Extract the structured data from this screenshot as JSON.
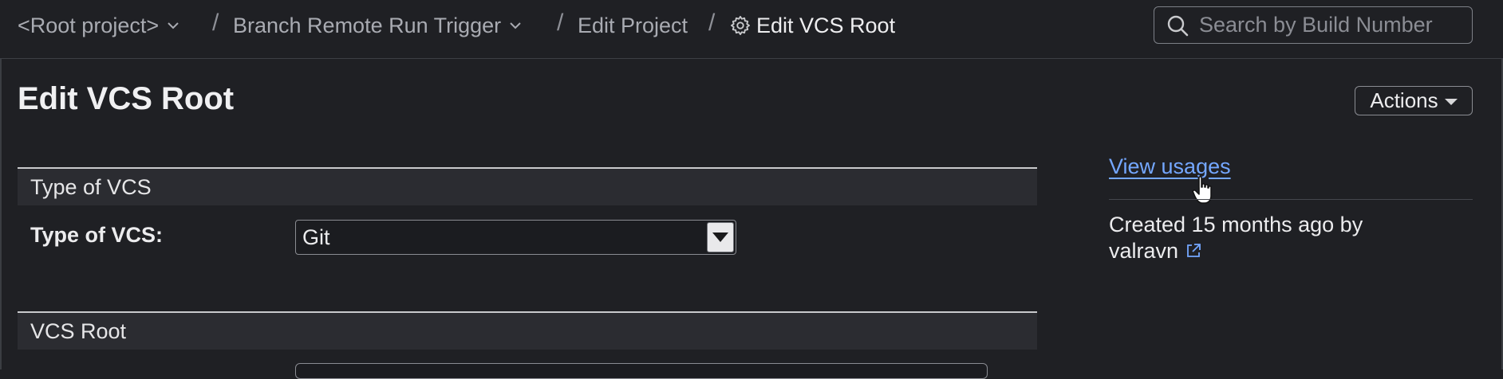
{
  "breadcrumb": {
    "root": "<Root project>",
    "project": "Branch Remote Run Trigger",
    "edit_project": "Edit Project",
    "current": "Edit VCS Root",
    "separator": "/"
  },
  "search": {
    "placeholder": "Search by Build Number"
  },
  "page": {
    "title": "Edit VCS Root",
    "actions_label": "Actions"
  },
  "sections": {
    "type_of_vcs_header": "Type of VCS",
    "type_of_vcs_label": "Type of VCS:",
    "type_of_vcs_value": "Git",
    "vcs_root_header": "VCS Root"
  },
  "sidebar": {
    "view_usages": "View usages",
    "created_prefix": "Created 15 months ago by",
    "created_by": "valravn"
  },
  "colors": {
    "background": "#1f2024",
    "link": "#74a7ff",
    "section_header_bg": "#2b2c31"
  },
  "icons": [
    "chevron-down-icon",
    "gear-icon",
    "search-icon",
    "dropdown-arrow-icon",
    "external-link-icon",
    "hand-cursor-icon"
  ]
}
